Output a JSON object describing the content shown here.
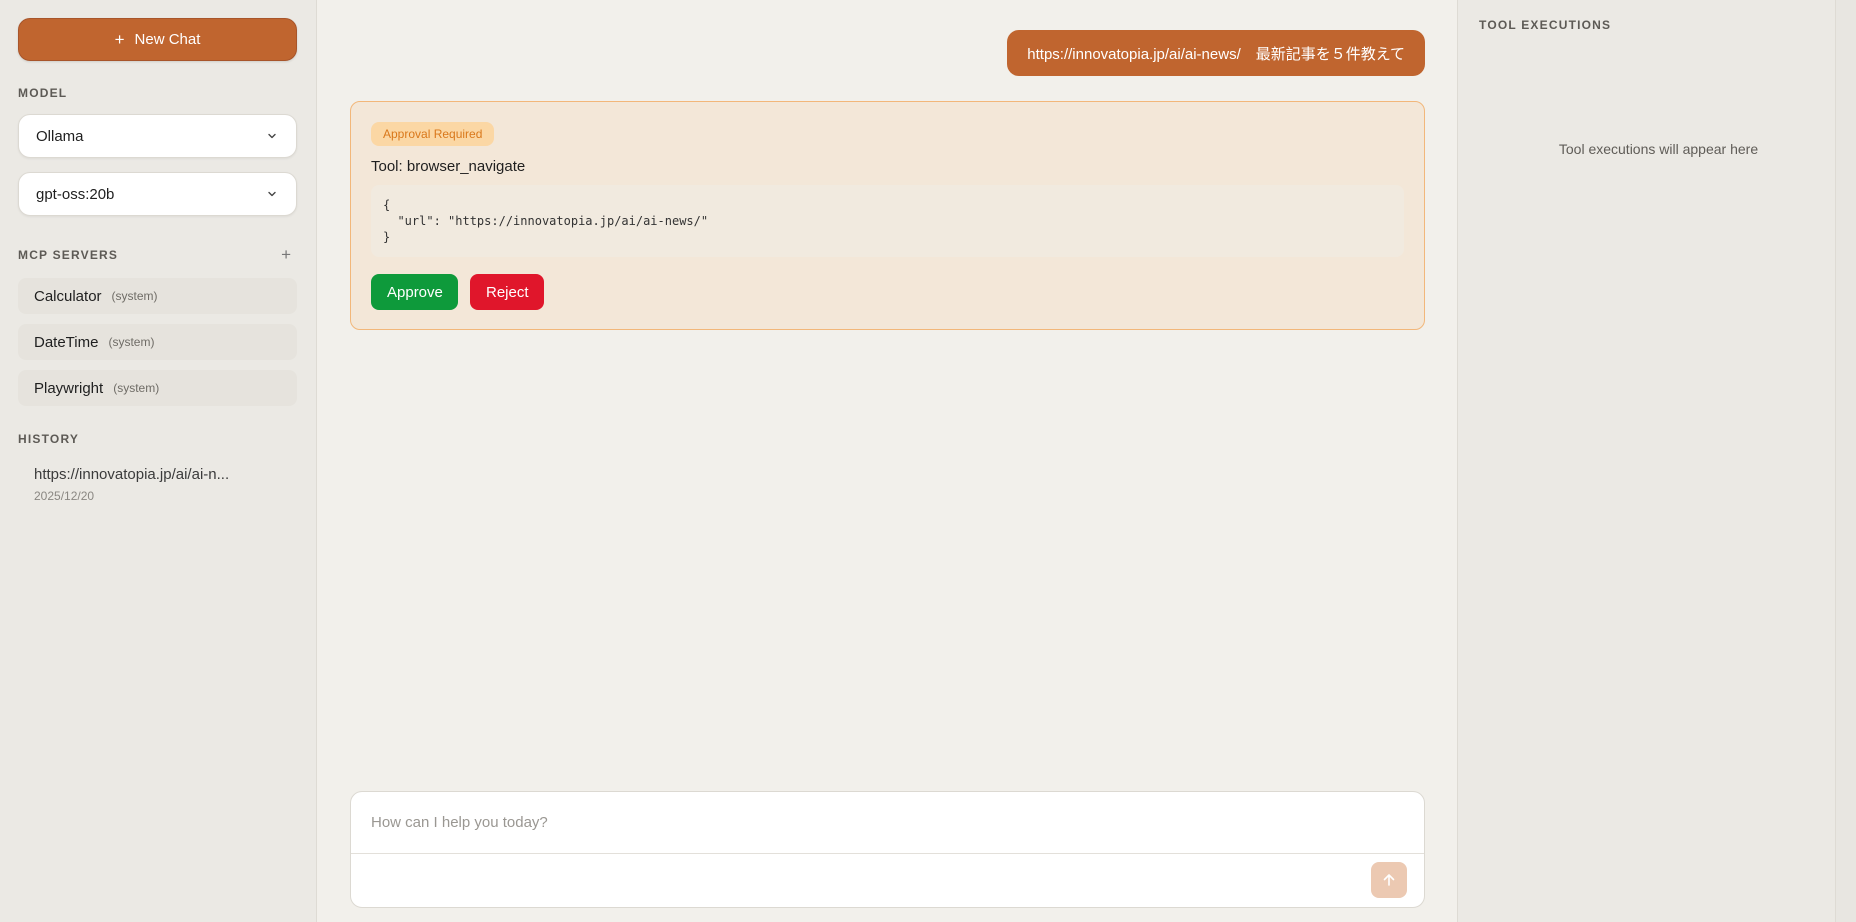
{
  "sidebar": {
    "new_chat_label": "New Chat",
    "model_label": "MODEL",
    "provider_select": "Ollama",
    "model_select": "gpt-oss:20b",
    "mcp_label": "MCP SERVERS",
    "mcp_add": "+",
    "servers": [
      {
        "name": "Calculator",
        "tag": "(system)"
      },
      {
        "name": "DateTime",
        "tag": "(system)"
      },
      {
        "name": "Playwright",
        "tag": "(system)"
      }
    ],
    "history_label": "HISTORY",
    "history": [
      {
        "title": "https://innovatopia.jp/ai/ai-n...",
        "date": "2025/12/20"
      }
    ]
  },
  "chat": {
    "user_message": "https://innovatopia.jp/ai/ai-news/　最新記事を５件教えて",
    "approval": {
      "badge": "Approval Required",
      "tool_line": "Tool: browser_navigate",
      "args": "{\n  \"url\": \"https://innovatopia.jp/ai/ai-news/\"\n}",
      "approve_label": "Approve",
      "reject_label": "Reject"
    },
    "composer_placeholder": "How can I help you today?"
  },
  "right_panel": {
    "title": "TOOL EXECUTIONS",
    "empty_text": "Tool executions will appear here"
  },
  "colors": {
    "accent": "#c0652f",
    "approve": "#0e9a3b",
    "reject": "#e0162b",
    "badge_text": "#d9781b"
  },
  "icons": {
    "new_chat": "plus-icon",
    "select": "chevron-down-icon",
    "send": "arrow-up-icon"
  }
}
